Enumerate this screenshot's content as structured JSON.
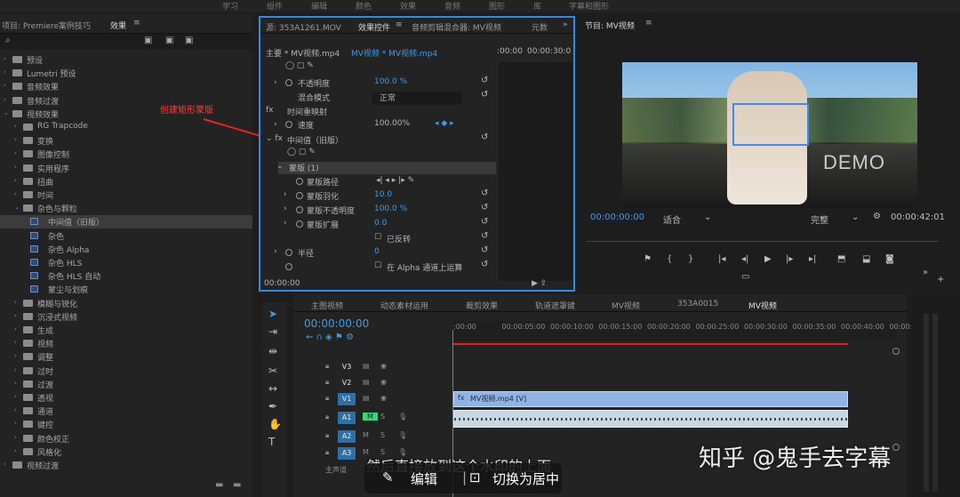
{
  "top_menu": {
    "items": [
      "学习",
      "组件",
      "编辑",
      "颜色",
      "效果",
      "音频",
      "图形",
      "库",
      "字幕和图形"
    ]
  },
  "project_panel": {
    "title": "项目: Premiere案例技巧",
    "effects_tab": "效果",
    "tree": [
      {
        "label": "预设",
        "indent": 0
      },
      {
        "label": "Lumetri 预设",
        "indent": 0
      },
      {
        "label": "音频效果",
        "indent": 0
      },
      {
        "label": "音频过渡",
        "indent": 0
      },
      {
        "label": "视频效果",
        "indent": 0,
        "open": true
      },
      {
        "label": "RG Trapcode",
        "indent": 1
      },
      {
        "label": "变换",
        "indent": 1
      },
      {
        "label": "图像控制",
        "indent": 1
      },
      {
        "label": "实用程序",
        "indent": 1
      },
      {
        "label": "扭曲",
        "indent": 1
      },
      {
        "label": "时间",
        "indent": 1
      },
      {
        "label": "杂色与颗粒",
        "indent": 1,
        "open": true
      },
      {
        "label": "中间值（旧版）",
        "indent": 2,
        "selected": true
      },
      {
        "label": "杂色",
        "indent": 2
      },
      {
        "label": "杂色 Alpha",
        "indent": 2
      },
      {
        "label": "杂色 HLS",
        "indent": 2
      },
      {
        "label": "杂色 HLS 自动",
        "indent": 2
      },
      {
        "label": "蒙尘与划痕",
        "indent": 2
      },
      {
        "label": "模糊与锐化",
        "indent": 1
      },
      {
        "label": "沉浸式视频",
        "indent": 1
      },
      {
        "label": "生成",
        "indent": 1
      },
      {
        "label": "视频",
        "indent": 1
      },
      {
        "label": "调整",
        "indent": 1
      },
      {
        "label": "过时",
        "indent": 1
      },
      {
        "label": "过渡",
        "indent": 1
      },
      {
        "label": "透视",
        "indent": 1
      },
      {
        "label": "通道",
        "indent": 1
      },
      {
        "label": "键控",
        "indent": 1
      },
      {
        "label": "颜色校正",
        "indent": 1
      },
      {
        "label": "风格化",
        "indent": 1
      },
      {
        "label": "视频过渡",
        "indent": 0
      }
    ]
  },
  "annotation": {
    "text": "创建矩形蒙版"
  },
  "effect_controls": {
    "tabs": {
      "source": "源: 353A1261.MOV",
      "fx": "效果控件",
      "mixer": "音频剪辑混合器: MV视频",
      "meta": "元数"
    },
    "master_label": "主要 * MV视频.mp4",
    "clip_label": "MV视频 * MV视频.mp4",
    "time_start": ":00:00",
    "time_end": "00:00:30:0",
    "opacity_label": "不透明度",
    "opacity_value": "100.0 %",
    "blend_label": "混合模式",
    "blend_value": "正常",
    "time_remap_label": "时间重映射",
    "speed_label": "速度",
    "speed_value": "100.00%",
    "median_label": "中间值（旧版）",
    "mask_label": "蒙版 (1)",
    "mask_path_label": "蒙版路径",
    "mask_feather_label": "蒙版羽化",
    "mask_feather_value": "10.0",
    "mask_opacity_label": "蒙版不透明度",
    "mask_opacity_value": "100.0 %",
    "mask_expand_label": "蒙版扩展",
    "mask_expand_value": "0.0",
    "inverted_label": "已反转",
    "radius_label": "半径",
    "radius_value": "0",
    "alpha_label": "在 Alpha 通道上运算",
    "timecode": "00:00:00"
  },
  "program_monitor": {
    "title": "节目: MV视频",
    "timecode": "00:00:00:00",
    "fit": "适合",
    "quality": "完整",
    "duration": "00:00:42:01",
    "demo_text": "DEMO"
  },
  "timeline": {
    "tabs": [
      "主图视频",
      "动态素材运用",
      "裁剪效果",
      "轨道遮罩键",
      "MV视频",
      "353A0015",
      "MV视频"
    ],
    "timecode": "00:00:00:00",
    "ticks": [
      ":00:00",
      "00:00:05:00",
      "00:00:10:00",
      "00:00:15:00",
      "00:00:20:00",
      "00:00:25:00",
      "00:00:30:00",
      "00:00:35:00",
      "00:00:40:00",
      "00:00:45:0"
    ],
    "tracks": [
      "V3",
      "V2",
      "V1",
      "A1",
      "A2",
      "A3"
    ],
    "master_label": "主声道",
    "video_clip": "MV视频.mp4 [V]"
  },
  "overlay": {
    "subtitle": "然后直接放到这个水印的上面",
    "edit_label": "编辑",
    "center_label": "切换为居中",
    "watermark": "知乎 @鬼手去字幕"
  }
}
